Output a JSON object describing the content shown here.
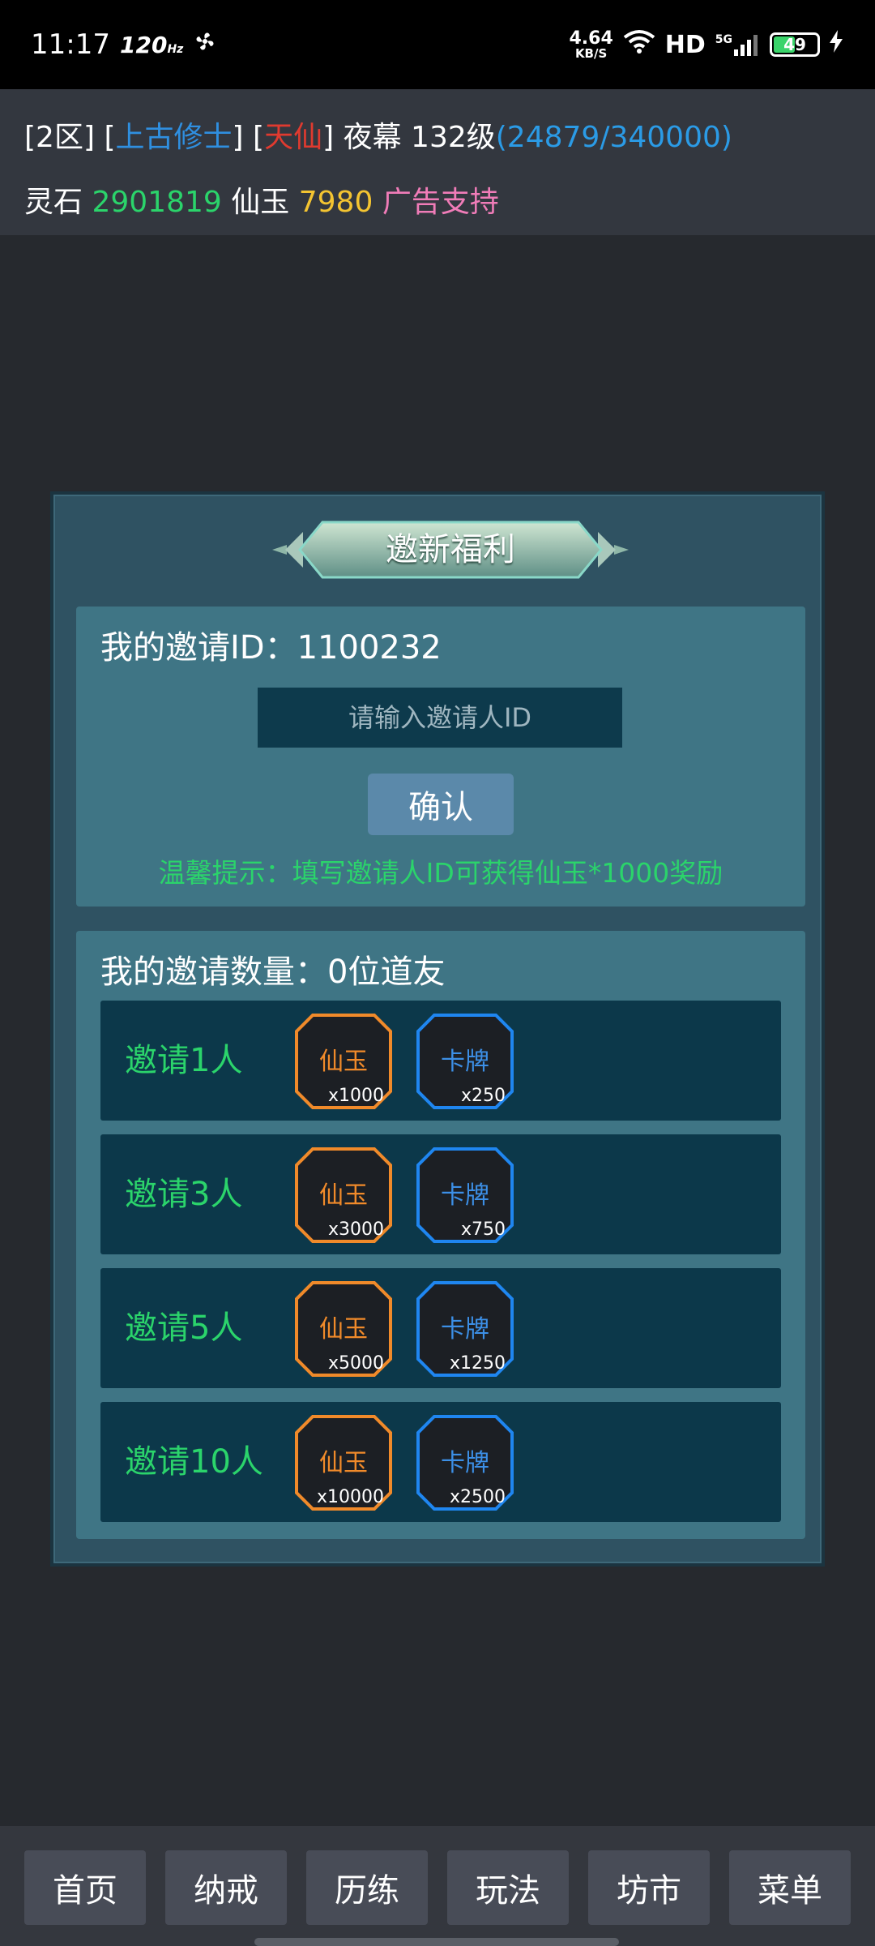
{
  "status_bar": {
    "time": "11:17",
    "refresh_rate": "120",
    "refresh_unit": "Hz",
    "net_speed_value": "4.64",
    "net_speed_unit": "KB/S",
    "hd": "HD",
    "network": "5G",
    "battery": "49"
  },
  "player": {
    "zone": "[2区]",
    "sect": "上古修士",
    "rank": "天仙",
    "name": "夜幕",
    "level": "132级",
    "exp": "(24879/340000)",
    "spirit_stone_label": "灵石",
    "spirit_stone_value": "2901819",
    "jade_label": "仙玉",
    "jade_value": "7980",
    "ad_support": "广告支持"
  },
  "panel": {
    "title": "邀新福利",
    "my_id_label": "我的邀请ID：1100232",
    "input_placeholder": "请输入邀请人ID",
    "confirm_label": "确认",
    "tip": "温馨提示：填写邀请人ID可获得仙玉*1000奖励",
    "count_label": "我的邀请数量：0位道友",
    "tiers": [
      {
        "label": "邀请1人",
        "rewards": [
          {
            "name": "仙玉",
            "qty": "x1000"
          },
          {
            "name": "卡牌",
            "qty": "x250"
          }
        ]
      },
      {
        "label": "邀请3人",
        "rewards": [
          {
            "name": "仙玉",
            "qty": "x3000"
          },
          {
            "name": "卡牌",
            "qty": "x750"
          }
        ]
      },
      {
        "label": "邀请5人",
        "rewards": [
          {
            "name": "仙玉",
            "qty": "x5000"
          },
          {
            "name": "卡牌",
            "qty": "x1250"
          }
        ]
      },
      {
        "label": "邀请10人",
        "rewards": [
          {
            "name": "仙玉",
            "qty": "x10000"
          },
          {
            "name": "卡牌",
            "qty": "x2500"
          }
        ]
      }
    ]
  },
  "nav": [
    "首页",
    "纳戒",
    "历练",
    "玩法",
    "坊市",
    "菜单"
  ],
  "colors": {
    "accent_green": "#2bd46b",
    "jade_orange": "#f08a2a",
    "card_blue": "#3c8fe6",
    "panel_bg": "#2f5262"
  }
}
